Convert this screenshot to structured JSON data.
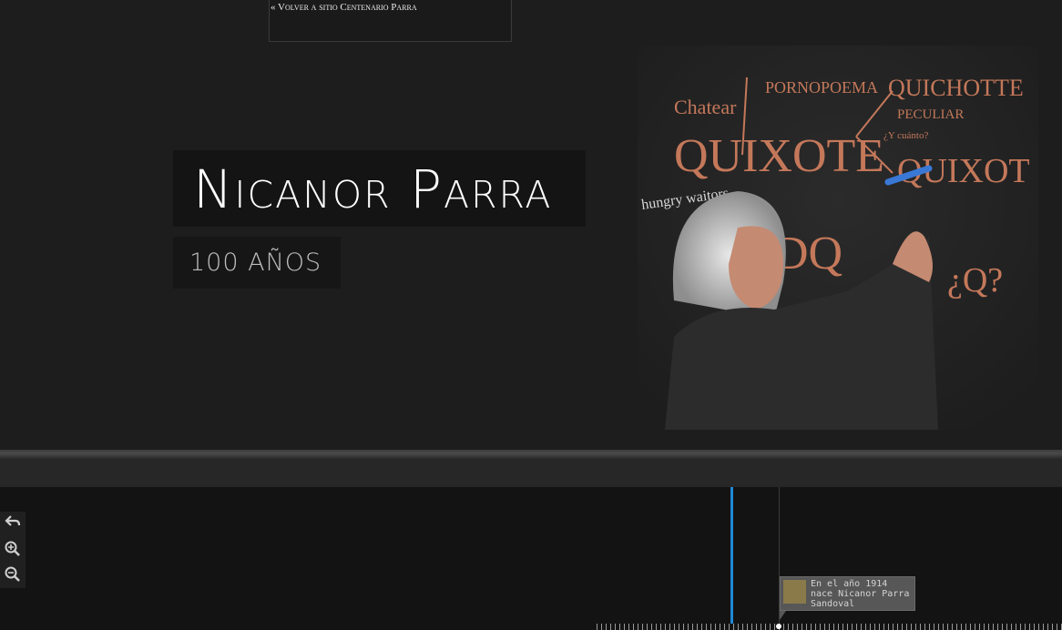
{
  "header": {
    "back_link": "« Volver a sitio Centenario Parra"
  },
  "hero": {
    "title": "Nicanor Parra",
    "subtitle": "100 AÑOS",
    "photo_icon": "portrait-chalkboard-image"
  },
  "timeline": {
    "tools": [
      "back-icon",
      "zoom-in-icon",
      "zoom-out-icon"
    ],
    "event_text": "En el año 1914 nace Nicanor Parra Sandoval",
    "event_icon": "photo-thumbnail-icon",
    "accent": "#1e88d6"
  }
}
